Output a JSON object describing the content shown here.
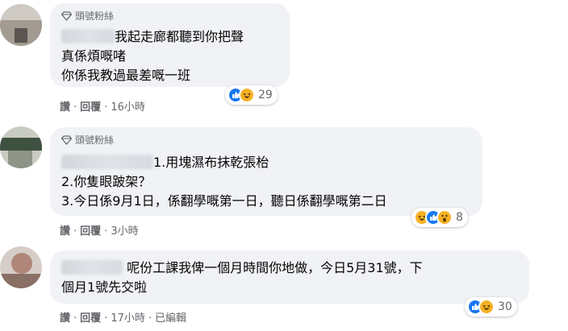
{
  "comments": [
    {
      "badge": "頭號粉絲",
      "lines": [
        "我起走廊都聽到你把聲",
        "真係煩嘅啫",
        "你係我教過最差嘅一班"
      ],
      "actions": {
        "like": "讚",
        "reply": "回覆",
        "time": "16小時"
      },
      "reactions": {
        "icons": [
          "like-icon",
          "haha-icon"
        ],
        "count": "29"
      }
    },
    {
      "badge": "頭號粉絲",
      "lines": [
        "1.用塊濕布抹乾張枱",
        "2.你隻眼跛架？",
        "3.今日係9月1日，係翻學嘅第一日，聽日係翻學嘅第二日"
      ],
      "actions": {
        "like": "讚",
        "reply": "回覆",
        "time": "3小時"
      },
      "reactions": {
        "icons": [
          "haha-icon",
          "like-icon",
          "wow-icon"
        ],
        "count": "8"
      }
    },
    {
      "badge": "",
      "lines": [
        "呢份工課我俾一個月時間你地做，今日5月31號，下",
        "個月1號先交啦"
      ],
      "actions": {
        "like": "讚",
        "reply": "回覆",
        "time": "17小時",
        "edited": "已編輯"
      },
      "reactions": {
        "icons": [
          "like-icon",
          "haha-icon"
        ],
        "count": "30"
      }
    }
  ],
  "colors": {
    "like": "#1877f2",
    "haha": "#f7b125",
    "bubble": "#f0f2f5",
    "meta": "#65676b"
  }
}
